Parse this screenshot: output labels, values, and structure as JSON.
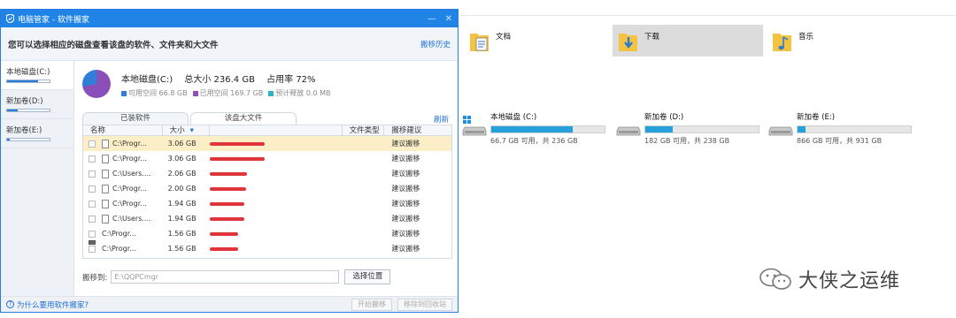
{
  "app": {
    "title": "电脑管家 - 软件搬家",
    "window_controls": {
      "minimize": "—",
      "close": "✕"
    },
    "info_message": "您可以选择相应的磁盘查看该盘的软件、文件夹和大文件",
    "history_link": "搬移历史",
    "colors": {
      "titlebar": "#1f84e6",
      "accent": "#2d7bd6",
      "link": "#1f6fd6",
      "size_bar": "#e0353b",
      "row_selected": "#fcefc8"
    },
    "drives": [
      {
        "label": "本地磁盘(C:)",
        "used_fraction": 0.72
      },
      {
        "label": "新加卷(D:)",
        "used_fraction": 0.24
      },
      {
        "label": "新加卷(E:)",
        "used_fraction": 0.07
      }
    ],
    "summary": {
      "drive_name": "本地磁盘(C:)",
      "total": "总大小 236.4 GB",
      "usage": "占用率 72%",
      "free": "可用空间 66.8 GB",
      "used": "已用空间 169.7 GB",
      "release": "预计释放 0.0 MB",
      "legend_colors": {
        "free": "#2f7fd8",
        "used": "#8a4fb8",
        "release": "#27b3c8"
      },
      "usage_fraction": 0.72
    },
    "tabs": [
      "已装软件",
      "该盘大文件"
    ],
    "refresh_link": "刷新",
    "table": {
      "columns": {
        "name": "名称",
        "size": "大小",
        "type": "文件类型",
        "advice": "搬移建议"
      },
      "sort_indicator": "▾",
      "rows": [
        {
          "name": "C:\\Progr...",
          "size": "3.06 GB",
          "size_gb": 3.06,
          "type": "",
          "advice": "建议搬移",
          "icon": "file-icon",
          "selected": true
        },
        {
          "name": "C:\\Progr...",
          "size": "3.06 GB",
          "size_gb": 3.06,
          "type": "",
          "advice": "建议搬移",
          "icon": "file-icon",
          "selected": false
        },
        {
          "name": "C:\\Users....",
          "size": "2.06 GB",
          "size_gb": 2.06,
          "type": "",
          "advice": "建议搬移",
          "icon": "file-icon",
          "selected": false
        },
        {
          "name": "C:\\Progr...",
          "size": "2.00 GB",
          "size_gb": 2.0,
          "type": "",
          "advice": "建议搬移",
          "icon": "file-icon",
          "selected": false
        },
        {
          "name": "C:\\Progr...",
          "size": "1.94 GB",
          "size_gb": 1.94,
          "type": "",
          "advice": "建议搬移",
          "icon": "file-icon",
          "selected": false
        },
        {
          "name": "C:\\Users....",
          "size": "1.94 GB",
          "size_gb": 1.94,
          "type": "",
          "advice": "建议搬移",
          "icon": "file-icon",
          "selected": false
        },
        {
          "name": "C:\\Progr...",
          "size": "1.56 GB",
          "size_gb": 1.56,
          "type": "",
          "advice": "建议搬移",
          "icon": "drive-icon",
          "selected": false
        },
        {
          "name": "C:\\Progr...",
          "size": "1.56 GB",
          "size_gb": 1.56,
          "type": "",
          "advice": "建议搬移",
          "icon": "drive-icon",
          "selected": false
        }
      ]
    },
    "move_to_label": "搬移到:",
    "move_to_value": "E:\\QQPCmgr",
    "choose_location": "选择位置",
    "help_link": "为什么要用软件搬家?",
    "start_move": "开始搬移",
    "move_recycle": "移除到回收站"
  },
  "explorer": {
    "folders": [
      {
        "label": "文档",
        "icon": "documents-folder-icon",
        "selected": false
      },
      {
        "label": "下载",
        "icon": "downloads-folder-icon",
        "selected": true
      },
      {
        "label": "音乐",
        "icon": "music-folder-icon",
        "selected": false
      }
    ],
    "drives": [
      {
        "name": "本地磁盘 (C:)",
        "free_text": "66.7 GB 可用，共 236 GB",
        "used_fraction": 0.72,
        "icon": "windows-drive-icon"
      },
      {
        "name": "新加卷 (D:)",
        "free_text": "182 GB 可用，共 238 GB",
        "used_fraction": 0.24,
        "icon": "drive-icon"
      },
      {
        "name": "新加卷 (E:)",
        "free_text": "866 GB 可用，共 931 GB",
        "used_fraction": 0.07,
        "icon": "drive-icon"
      }
    ],
    "bar_color": "#26a0da"
  },
  "watermark": {
    "text": "大侠之运维",
    "icon": "wechat-icon"
  }
}
